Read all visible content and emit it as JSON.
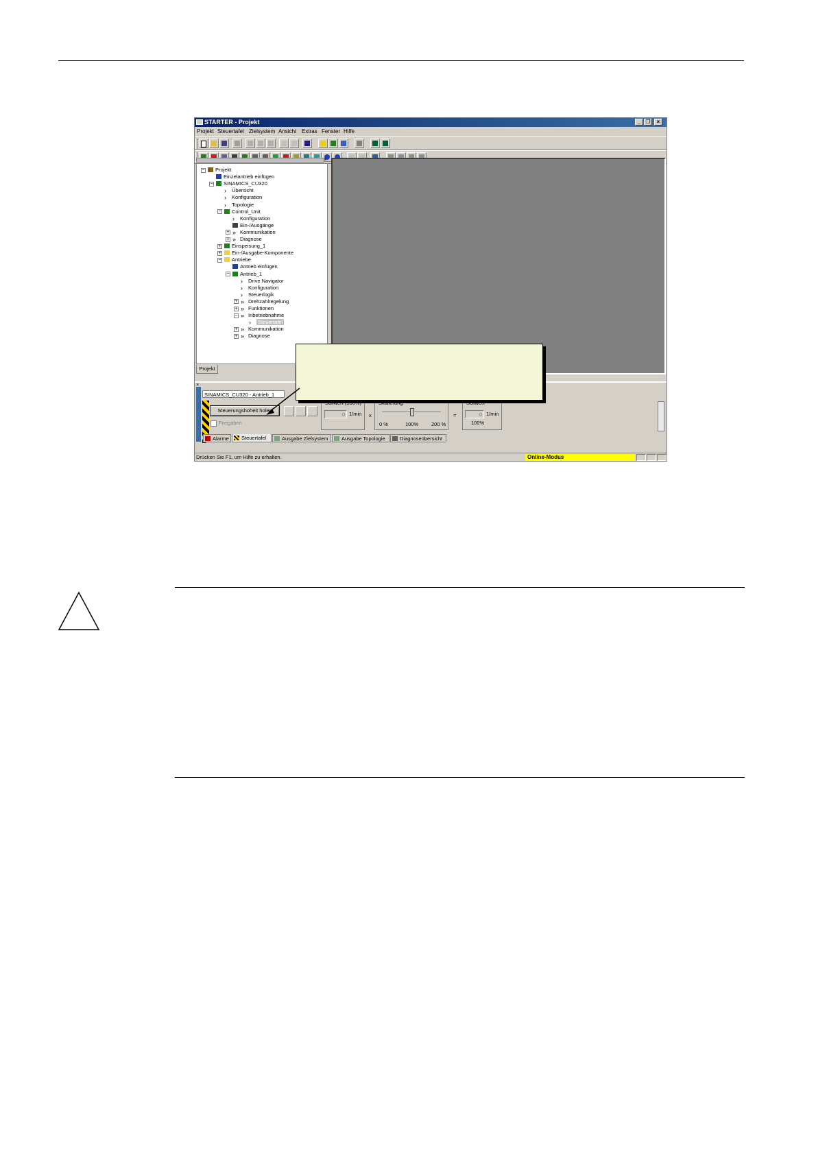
{
  "window": {
    "title": "STARTER - Projekt",
    "controls": [
      "minimize-icon",
      "restore-icon",
      "close-icon"
    ]
  },
  "menu": [
    "Projekt",
    "Steuertafel",
    "Zielsystem",
    "Ansicht",
    "Extras",
    "Fenster",
    "Hilfe"
  ],
  "tree": {
    "nodes": [
      {
        "label": "Projekt",
        "level": 0,
        "expander": "minus",
        "icon": "project-icon"
      },
      {
        "label": "Einzelantrieb einfügen",
        "level": 1,
        "icon": "insert-drive-icon"
      },
      {
        "label": "SINAMICS_CU320",
        "level": 1,
        "expander": "minus",
        "icon": "device-icon"
      },
      {
        "label": "Übersicht",
        "level": 2,
        "icon": "arrow-icon"
      },
      {
        "label": "Konfiguration",
        "level": 2,
        "icon": "arrow-icon"
      },
      {
        "label": "Topologie",
        "level": 2,
        "icon": "arrow-icon"
      },
      {
        "label": "Control_Unit",
        "level": 2,
        "expander": "minus",
        "icon": "control-unit-icon"
      },
      {
        "label": "Konfiguration",
        "level": 3,
        "icon": "arrow-icon"
      },
      {
        "label": "Ein-/Ausgänge",
        "level": 3,
        "icon": "io-icon"
      },
      {
        "label": "Kommunikation",
        "level": 3,
        "expander": "plus",
        "icon": "double-arrow-icon"
      },
      {
        "label": "Diagnose",
        "level": 3,
        "expander": "plus",
        "icon": "double-arrow-icon"
      },
      {
        "label": "Einspeisung_1",
        "level": 2,
        "expander": "plus",
        "icon": "infeed-icon"
      },
      {
        "label": "Ein-/Ausgabe-Komponente",
        "level": 2,
        "expander": "plus",
        "icon": "folder-icon"
      },
      {
        "label": "Antriebe",
        "level": 2,
        "expander": "minus",
        "icon": "folder-icon"
      },
      {
        "label": "Antrieb einfügen",
        "level": 3,
        "icon": "insert-drive-icon"
      },
      {
        "label": "Antrieb_1",
        "level": 3,
        "expander": "minus",
        "icon": "drive-icon"
      },
      {
        "label": "Drive Navigator",
        "level": 4,
        "icon": "arrow-icon"
      },
      {
        "label": "Konfiguration",
        "level": 4,
        "icon": "arrow-icon"
      },
      {
        "label": "Steuerlogik",
        "level": 4,
        "icon": "arrow-icon"
      },
      {
        "label": "Drehzahlregelung",
        "level": 4,
        "expander": "plus",
        "icon": "double-arrow-icon"
      },
      {
        "label": "Funktionen",
        "level": 4,
        "expander": "plus",
        "icon": "double-arrow-icon"
      },
      {
        "label": "Inbetriebnahme",
        "level": 4,
        "expander": "minus",
        "icon": "double-arrow-icon"
      },
      {
        "label": "Steuertafel",
        "level": 5,
        "icon": "arrow-icon",
        "selected": true
      },
      {
        "label": "Kommunikation",
        "level": 4,
        "expander": "plus",
        "icon": "double-arrow-icon"
      },
      {
        "label": "Diagnose",
        "level": 4,
        "expander": "plus",
        "icon": "double-arrow-icon"
      }
    ],
    "tab": "Projekt"
  },
  "control_panel": {
    "device": "SINAMICS_CU320 - Antrieb_1",
    "take_control_button": "Steuerungshoheit holen",
    "enable_label": "Freigaben",
    "setpoint_group": "Sollwert (100%)",
    "setpoint_value": "0",
    "setpoint_unit": "1/min",
    "multiply": "x",
    "scaling_group": "Skalierung",
    "scale_min": "0 %",
    "scale_mid": "100%",
    "scale_max": "200 %",
    "scale_level_percent": 100,
    "equals": "=",
    "result_group": "Sollwert",
    "result_value": "0",
    "result_unit": "1/min",
    "result_percent": "100%"
  },
  "bottom_tabs": [
    "Alarme",
    "Steuertafel",
    "Ausgabe Zielsystem",
    "Ausgabe Topologie",
    "Diagnoseübersicht"
  ],
  "status": {
    "help": "Drücken Sie F1, um Hilfe zu erhalten.",
    "mode": "Online-Modus"
  },
  "colors": {
    "titlebar": "#0a246a",
    "workspace": "#808080",
    "online": "#ffff00",
    "callout": "#f2f5d6"
  }
}
